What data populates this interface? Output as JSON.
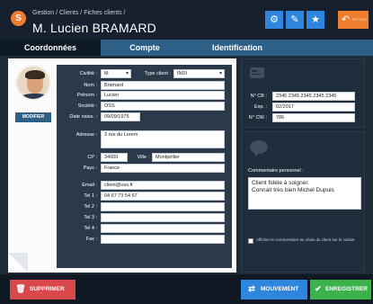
{
  "header": {
    "breadcrumb": "Gestion / Clients / Fiches clients /",
    "title": "M. Lucien BRAMARD",
    "logo_letter": "S",
    "retour_label": "RETOUR",
    "icons": [
      "gear-icon",
      "pencil-icon",
      "star-icon",
      "back-icon"
    ]
  },
  "tabs": [
    {
      "label": "Coordonnées",
      "active": true
    },
    {
      "label": "Compte",
      "active": false
    },
    {
      "label": "Identification",
      "active": false
    }
  ],
  "identity": {
    "civilite_label": "Civilité :",
    "civilite_value": "M",
    "type_client_label": "Type client :",
    "type_client_value": "INDI",
    "nom_label": "Nom :",
    "nom_value": "Bramard",
    "prenom_label": "Prénom :",
    "prenom_value": "Lucien",
    "societe_label": "Société :",
    "societe_value": "OSS",
    "naissance_label": "Date naiss. :",
    "naissance_value": "09/09/1975",
    "modifier_label": "MODIFIER"
  },
  "address": {
    "adresse_label": "Adresse :",
    "adresse_value": "3 rue du Lorem",
    "cp_label": "CP :",
    "cp_value": "34000",
    "ville_label": "Ville :",
    "ville_value": "Montpellier",
    "pays_label": "Pays :",
    "pays_value": "France"
  },
  "contact": {
    "email_label": "Email :",
    "email_value": "client@oss.fr",
    "tel1_label": "Tel 1 :",
    "tel1_value": "04 67 73 54 67",
    "tel2_label": "Tel 2 :",
    "tel2_value": "",
    "tel3_label": "Tel 3 :",
    "tel3_value": "",
    "tel4_label": "Tel 4 :",
    "tel4_value": "",
    "fax_label": "Fax :",
    "fax_value": ""
  },
  "card": {
    "cb_label": "N° CB :",
    "cb_value": "2345 2345 2345 2345 2345",
    "exp_label": "Exp. :",
    "exp_value": "02/2017",
    "cni_label": "N° CNI :",
    "cni_value": "786"
  },
  "comment": {
    "label": "Commentaire personnel :",
    "value": "Client fidèle à soigner.\nConnait très bien Michel Dupuis",
    "checkbox_label": "Afficher le commentaire au choix du client sur le caisse",
    "checked": false
  },
  "footer": {
    "delete_label": "SUPPRIMER",
    "mouvement_label": "MOUVEMENT",
    "save_label": "ENREGISTRER"
  },
  "colors": {
    "header_bg": "#17202e",
    "accent_blue": "#2e86de",
    "accent_orange": "#f07c2e",
    "delete_red": "#d9484a",
    "save_green": "#3cb34a"
  }
}
